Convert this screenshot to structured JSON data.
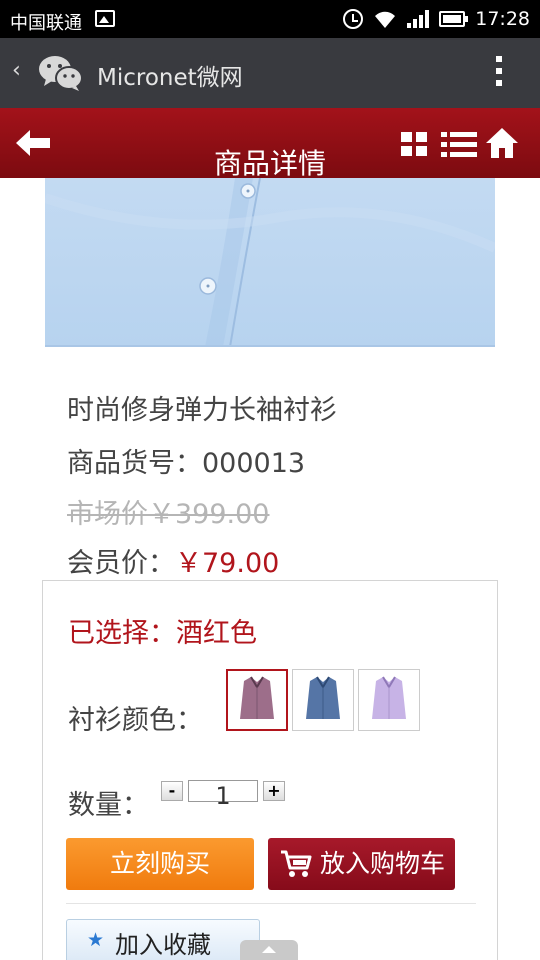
{
  "status_bar": {
    "carrier": "中国联通",
    "time": "17:28"
  },
  "wechat_bar": {
    "title": "Micronet微网"
  },
  "header": {
    "title": "商品详情"
  },
  "product": {
    "name": "时尚修身弹力长袖衬衫",
    "code_label": "商品货号：",
    "code_value": "000013",
    "market_label": "市场价",
    "market_price": "￥399.00",
    "member_label": "会员价：",
    "member_price": "￥79.00"
  },
  "options": {
    "selected_label": "已选择：",
    "selected_value": "酒红色",
    "color_label": "衬衫颜色：",
    "swatches": [
      {
        "name": "酒红色",
        "color": "#9d6e8a"
      },
      {
        "name": "蓝色",
        "color": "#5575a6"
      },
      {
        "name": "淡紫色",
        "color": "#c7b3e6"
      }
    ],
    "quantity_label": "数量：",
    "quantity_minus": "-",
    "quantity_value": "1",
    "quantity_plus": "+"
  },
  "actions": {
    "buy_now": "立刻购买",
    "add_to_cart": "放入购物车",
    "add_to_favorites": "加入收藏"
  },
  "colors": {
    "header_red": "#a3121a",
    "price_red": "#b1151c",
    "buy_orange": "#f58a1f",
    "cart_red": "#941224"
  }
}
